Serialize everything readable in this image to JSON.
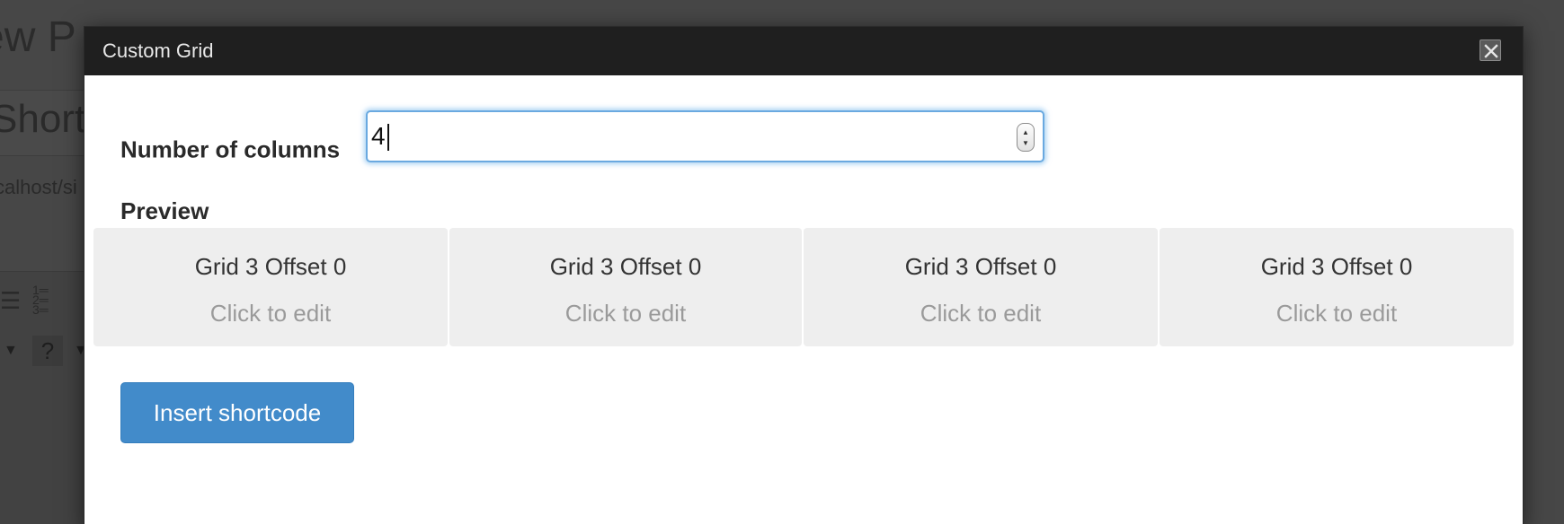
{
  "background": {
    "page_title": "ew P",
    "section_title": "Shortc",
    "url_fragment": "calhost/si"
  },
  "dialog": {
    "title": "Custom Grid",
    "columns_label": "Number of columns",
    "columns_value": "4",
    "preview_label": "Preview",
    "cells": [
      {
        "title": "Grid 3 Offset 0",
        "subtitle": "Click to edit"
      },
      {
        "title": "Grid 3 Offset 0",
        "subtitle": "Click to edit"
      },
      {
        "title": "Grid 3 Offset 0",
        "subtitle": "Click to edit"
      },
      {
        "title": "Grid 3 Offset 0",
        "subtitle": "Click to edit"
      }
    ],
    "insert_label": "Insert shortcode",
    "colors": {
      "header": "#1f1f1f",
      "button": "#428bca",
      "focus": "#66afe9",
      "cell": "#eeeeee"
    }
  }
}
